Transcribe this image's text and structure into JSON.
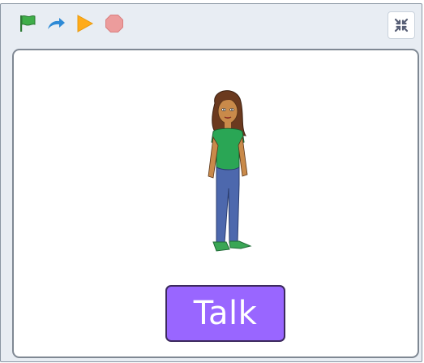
{
  "toolbar": {
    "green_flag_icon": "green-flag-icon",
    "redo_icon": "redo-arrow-icon",
    "play_icon": "play-icon",
    "stop_icon": "stop-icon",
    "fullscreen_icon": "exit-fullscreen-icon"
  },
  "stage": {
    "sprite": "girl-character",
    "button_label": "Talk"
  },
  "colors": {
    "flag": "#3fae49",
    "redo": "#2d8ad6",
    "play": "#ffab19",
    "stop": "#ec9c9c",
    "talk_button": "#9966ff"
  }
}
